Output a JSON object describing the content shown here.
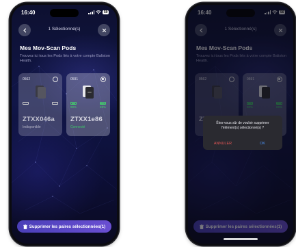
{
  "status": {
    "time": "16:40",
    "battery": "50"
  },
  "header": {
    "title": "1 Sélectionné(s)"
  },
  "section": {
    "title": "Mes Mov-Scan Pods",
    "description": "Trouvez ici tous les Pods liés à votre compte Baliston Health."
  },
  "pods": [
    {
      "id": "0562",
      "name": "ZTXX046a",
      "status": "Indisponible",
      "selected": false
    },
    {
      "id": "0591",
      "name": "ZTXX1e86",
      "status": "Connecté",
      "selected": true,
      "battery_left": "90%",
      "battery_right": "69%"
    }
  ],
  "bottom_button": {
    "label": "Supprimer les paires sélectionnées(1)"
  },
  "dialog": {
    "message": "Êtes-vous sûr de vouloir supprimer l'élément(s) sélectionné(s) ?",
    "cancel": "ANNULER",
    "ok": "OK"
  },
  "colors": {
    "accent": "#5a46c8",
    "connected": "#3ec86a",
    "cancel": "#e05555",
    "ok": "#4a8ff0"
  }
}
